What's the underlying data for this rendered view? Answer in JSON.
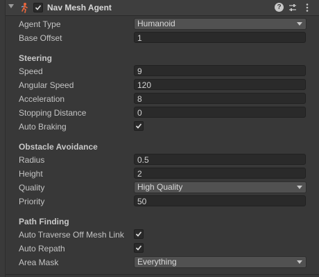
{
  "component": {
    "title": "Nav Mesh Agent",
    "enabled": true,
    "icons": {
      "component": "navmesh-agent-icon",
      "help": "help-icon",
      "presets": "presets-icon",
      "menu": "kebab-menu-icon"
    }
  },
  "fields": {
    "agent_type": {
      "label": "Agent Type",
      "value": "Humanoid"
    },
    "base_offset": {
      "label": "Base Offset",
      "value": "1"
    }
  },
  "steering": {
    "header": "Steering",
    "speed": {
      "label": "Speed",
      "value": "9"
    },
    "angular_speed": {
      "label": "Angular Speed",
      "value": "120"
    },
    "acceleration": {
      "label": "Acceleration",
      "value": "8"
    },
    "stopping_distance": {
      "label": "Stopping Distance",
      "value": "0"
    },
    "auto_braking": {
      "label": "Auto Braking",
      "checked": true
    }
  },
  "obstacle": {
    "header": "Obstacle Avoidance",
    "radius": {
      "label": "Radius",
      "value": "0.5"
    },
    "height": {
      "label": "Height",
      "value": "2"
    },
    "quality": {
      "label": "Quality",
      "value": "High Quality"
    },
    "priority": {
      "label": "Priority",
      "value": "50"
    }
  },
  "path": {
    "header": "Path Finding",
    "auto_traverse": {
      "label": "Auto Traverse Off Mesh Link",
      "checked": true
    },
    "auto_repath": {
      "label": "Auto Repath",
      "checked": true
    },
    "area_mask": {
      "label": "Area Mask",
      "value": "Everything"
    }
  },
  "colors": {
    "background": "#383838",
    "field": "#2a2a2a",
    "dropdown": "#515151",
    "text": "#c4c4c4",
    "icon_accent": "#e8663d"
  }
}
